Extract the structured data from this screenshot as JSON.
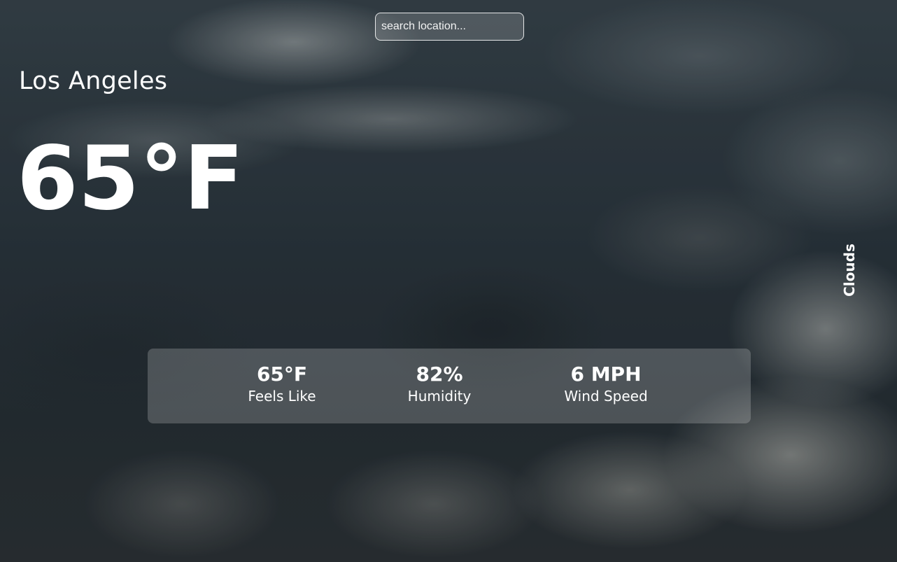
{
  "search": {
    "placeholder": "search location..."
  },
  "location": {
    "city": "Los Angeles"
  },
  "current": {
    "temperature": "65°F",
    "condition": "Clouds"
  },
  "stats": [
    {
      "value": "65°F",
      "label": "Feels Like"
    },
    {
      "value": "82%",
      "label": "Humidity"
    },
    {
      "value": "6 MPH",
      "label": "Wind Speed"
    }
  ],
  "colors": {
    "text": "#ffffff",
    "panel": "rgba(255,255,255,0.2)"
  }
}
